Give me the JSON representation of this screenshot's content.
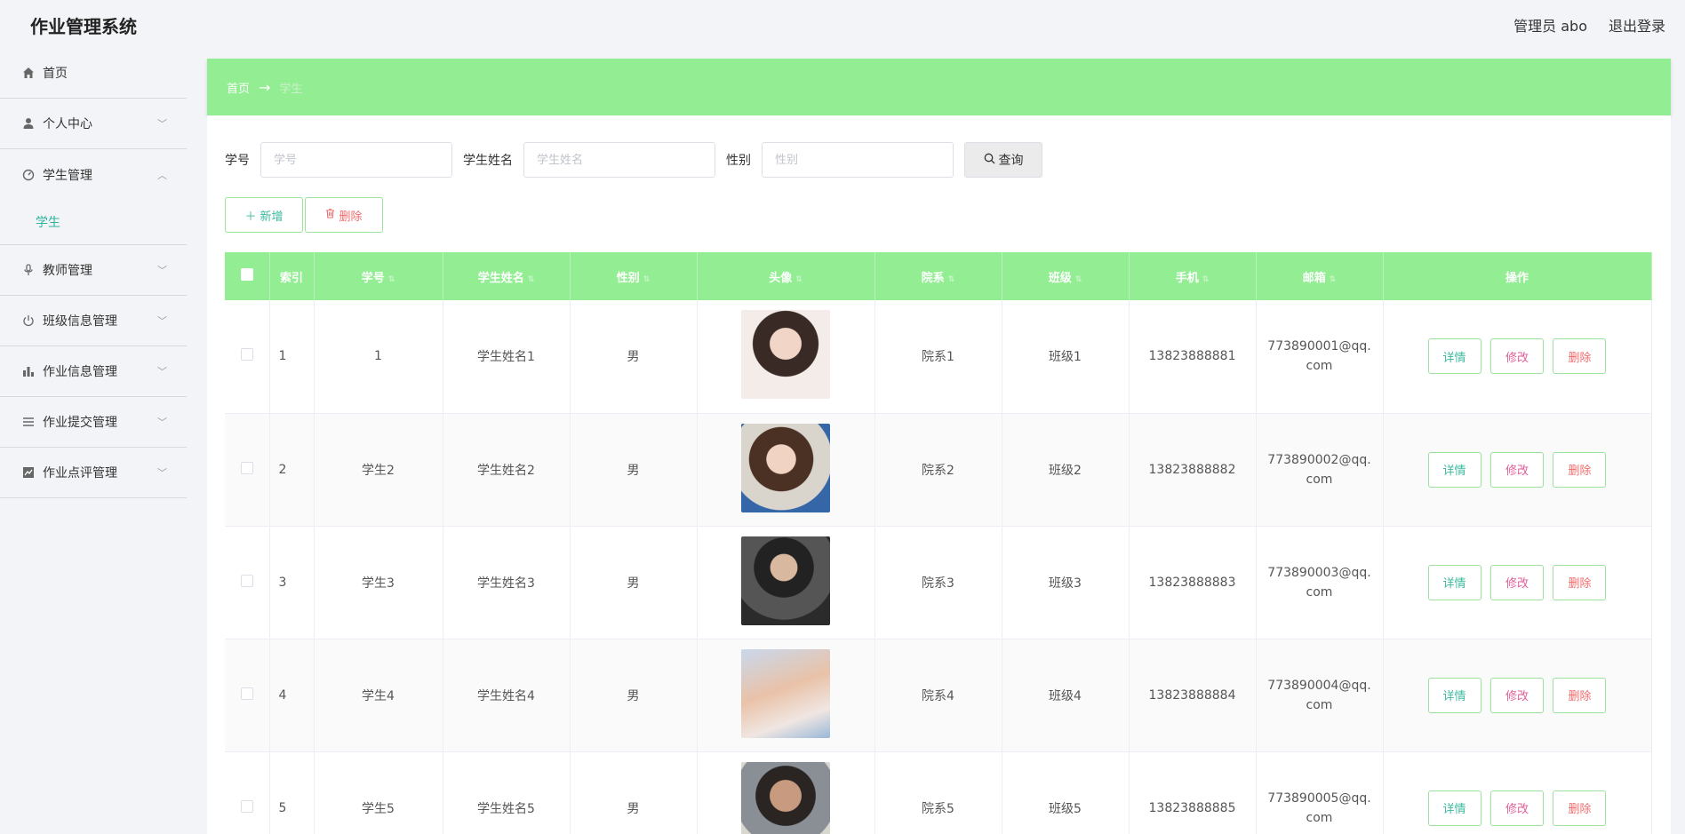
{
  "app": {
    "title": "作业管理系统"
  },
  "header": {
    "user": "管理员 abo",
    "logout": "退出登录"
  },
  "sidebar": {
    "items": [
      {
        "label": "首页",
        "icon": "home-icon"
      },
      {
        "label": "个人中心",
        "icon": "user-icon"
      },
      {
        "label": "学生管理",
        "icon": "dashboard-icon",
        "expanded": true,
        "children": [
          "学生"
        ]
      },
      {
        "label": "教师管理",
        "icon": "mic-icon"
      },
      {
        "label": "班级信息管理",
        "icon": "power-icon"
      },
      {
        "label": "作业信息管理",
        "icon": "bar-chart-icon"
      },
      {
        "label": "作业提交管理",
        "icon": "list-icon"
      },
      {
        "label": "作业点评管理",
        "icon": "chart-icon"
      }
    ]
  },
  "breadcrumb": {
    "home": "首页",
    "separator": "→",
    "current": "学生"
  },
  "search": {
    "fields": [
      {
        "label": "学号",
        "placeholder": "学号"
      },
      {
        "label": "学生姓名",
        "placeholder": "学生姓名"
      },
      {
        "label": "性别",
        "placeholder": "性别"
      }
    ],
    "button": "查询"
  },
  "actions": {
    "add": "新增",
    "delete": "删除"
  },
  "table": {
    "columns": [
      "索引",
      "学号",
      "学生姓名",
      "性别",
      "头像",
      "院系",
      "班级",
      "手机",
      "邮箱",
      "操作"
    ],
    "rows": [
      {
        "idx": "1",
        "xh": "1",
        "name": "学生姓名1",
        "gender": "男",
        "dept": "院系1",
        "cls": "班级1",
        "phone": "13823888881",
        "email": "773890001@qq.com"
      },
      {
        "idx": "2",
        "xh": "学生2",
        "name": "学生姓名2",
        "gender": "男",
        "dept": "院系2",
        "cls": "班级2",
        "phone": "13823888882",
        "email": "773890002@qq.com"
      },
      {
        "idx": "3",
        "xh": "学生3",
        "name": "学生姓名3",
        "gender": "男",
        "dept": "院系3",
        "cls": "班级3",
        "phone": "13823888883",
        "email": "773890003@qq.com"
      },
      {
        "idx": "4",
        "xh": "学生4",
        "name": "学生姓名4",
        "gender": "男",
        "dept": "院系4",
        "cls": "班级4",
        "phone": "13823888884",
        "email": "773890004@qq.com"
      },
      {
        "idx": "5",
        "xh": "学生5",
        "name": "学生姓名5",
        "gender": "男",
        "dept": "院系5",
        "cls": "班级5",
        "phone": "13823888885",
        "email": "773890005@qq.com"
      }
    ],
    "row_actions": {
      "detail": "详情",
      "edit": "修改",
      "delete": "删除"
    }
  },
  "colors": {
    "accent": "#93ee93",
    "teal": "#3cba9f",
    "danger": "#f06c6c",
    "edit": "#e0609a"
  }
}
